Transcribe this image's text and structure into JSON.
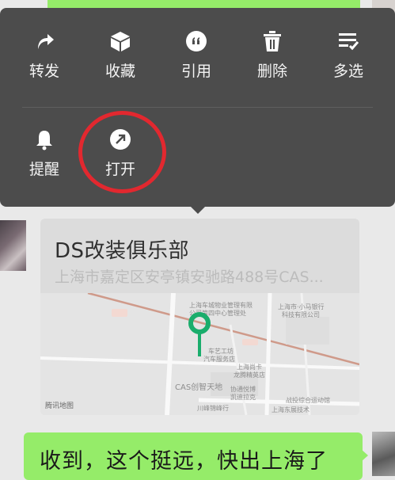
{
  "menu": {
    "row1": [
      {
        "label": "转发",
        "icon": "share-arrow-icon"
      },
      {
        "label": "收藏",
        "icon": "cube-icon"
      },
      {
        "label": "引用",
        "icon": "quote-icon"
      },
      {
        "label": "删除",
        "icon": "trash-icon"
      },
      {
        "label": "多选",
        "icon": "multi-select-icon"
      }
    ],
    "row2": [
      {
        "label": "提醒",
        "icon": "bell-icon"
      },
      {
        "label": "打开",
        "icon": "open-arrow-icon"
      }
    ]
  },
  "location_card": {
    "title": "DS改装俱乐部",
    "address": "上海市嘉定区安亭镇安驰路488号CAS...",
    "map_logo": "腾讯地图",
    "map_labels": [
      "上海车城物业管理有限",
      "公司第四中心管理处",
      "上海市·小马银行",
      "科技有限公司",
      "车艺工坊",
      "汽车服务店",
      "上海尚卡",
      "龙腾精英店",
      "CAS创智天地",
      "协通悦博",
      "凯迪拉克",
      "战投综合运动馆",
      "川峰锦峰行",
      "上海东展技术"
    ]
  },
  "reply": {
    "text": "收到，这个挺远，快出上海了"
  },
  "colors": {
    "menu_bg": "#4c4c4c",
    "bubble_green": "#95ec69",
    "annotation_red": "#e2282f",
    "pin_green": "#1aad6c"
  }
}
